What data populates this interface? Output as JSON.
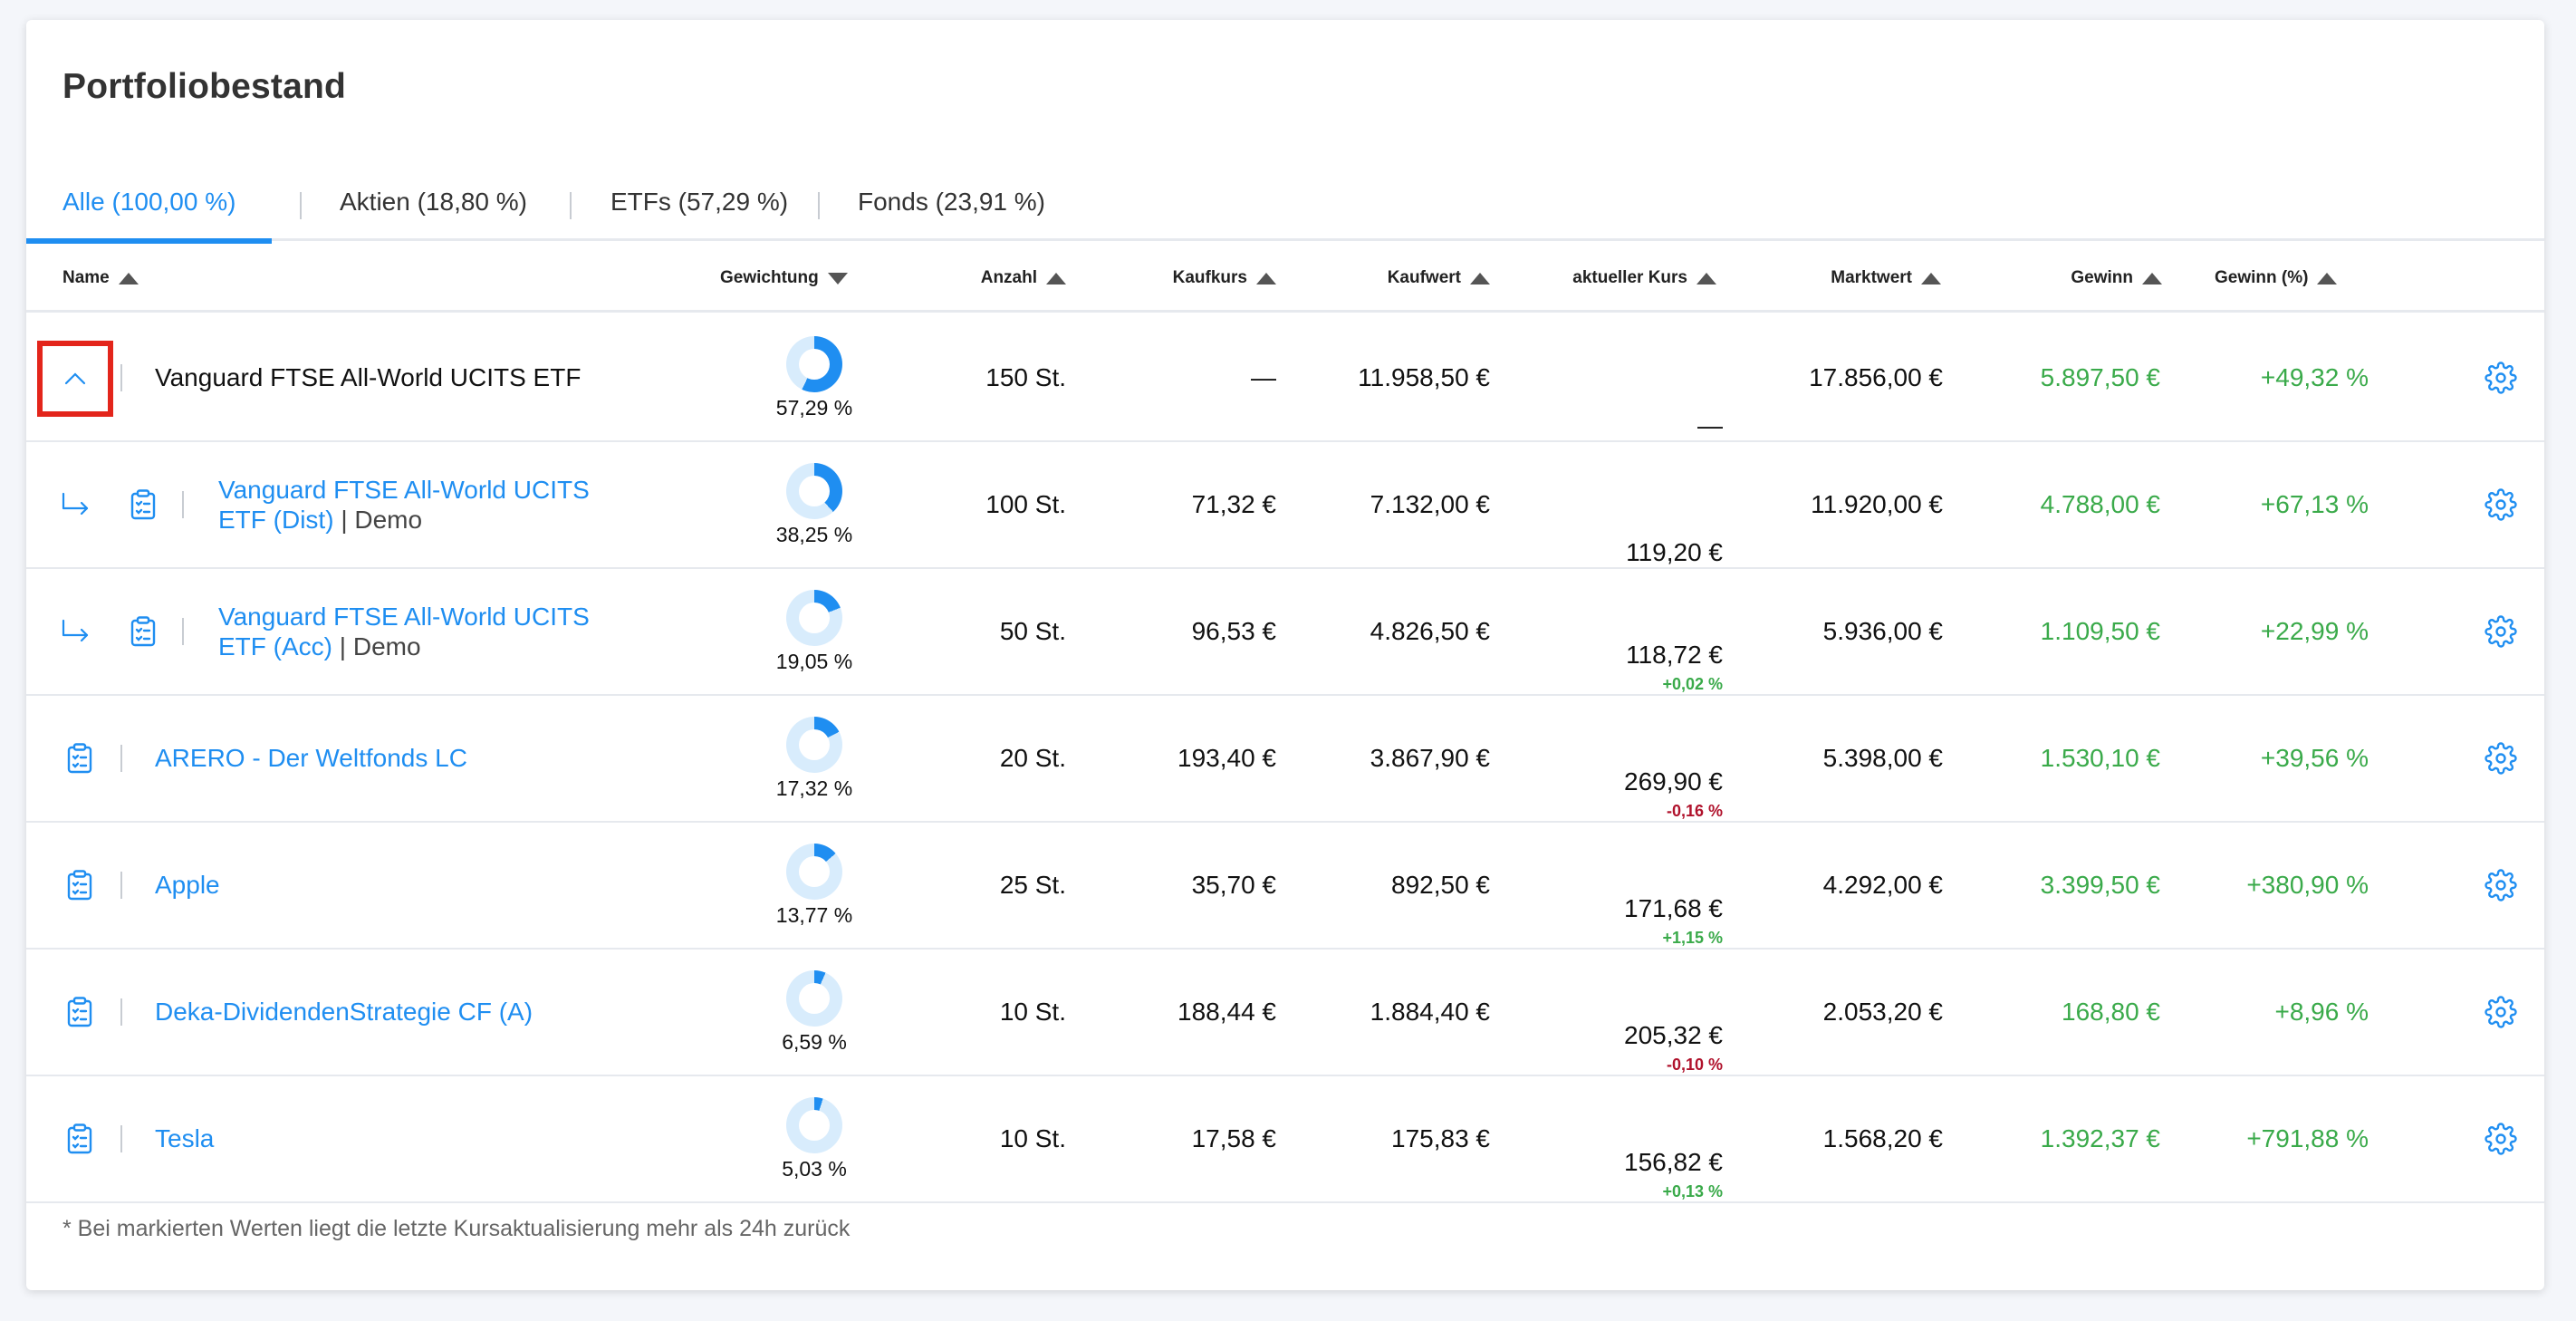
{
  "title": "Portfoliobestand",
  "tabs": [
    {
      "label": "Alle (100,00 %)"
    },
    {
      "label": "Aktien (18,80 %)"
    },
    {
      "label": "ETFs (57,29 %)"
    },
    {
      "label": "Fonds (23,91 %)"
    }
  ],
  "columns": {
    "name": "Name",
    "gewichtung": "Gewichtung",
    "anzahl": "Anzahl",
    "kaufkurs": "Kaufkurs",
    "kaufwert": "Kaufwert",
    "aktueller_kurs": "aktueller Kurs",
    "marktwert": "Marktwert",
    "gewinn": "Gewinn",
    "gewinn_pct": "Gewinn (%)"
  },
  "colors": {
    "accent": "#1f8ef1",
    "positive": "#3aaa4a",
    "negative": "#b0122c",
    "highlight_box": "#e3251b",
    "donut_light": "#d8ecfc"
  },
  "rows": [
    {
      "name": "Vanguard FTSE All-World UCITS ETF",
      "weight_label": "57,29 %",
      "weight": 57.29,
      "anzahl": "150 St.",
      "kaufkurs": "—",
      "kaufwert": "11.958,50 €",
      "kurs": "—",
      "kurs_change": "",
      "marktwert": "17.856,00 €",
      "gewinn": "5.897,50 €",
      "gewinn_pct": "+49,32 %"
    },
    {
      "name_line1": "Vanguard FTSE All-World UCITS",
      "name_line2": "ETF (Dist)",
      "suffix": "Demo",
      "weight_label": "38,25 %",
      "weight": 38.25,
      "anzahl": "100 St.",
      "kaufkurs": "71,32 €",
      "kaufwert": "7.132,00 €",
      "kurs": "119,20 €",
      "kurs_change": "",
      "marktwert": "11.920,00 €",
      "gewinn": "4.788,00 €",
      "gewinn_pct": "+67,13 %"
    },
    {
      "name_line1": "Vanguard FTSE All-World UCITS",
      "name_line2": "ETF (Acc)",
      "suffix": "Demo",
      "weight_label": "19,05 %",
      "weight": 19.05,
      "anzahl": "50 St.",
      "kaufkurs": "96,53 €",
      "kaufwert": "4.826,50 €",
      "kurs": "118,72 €",
      "kurs_change": "+0,02 %",
      "marktwert": "5.936,00 €",
      "gewinn": "1.109,50 €",
      "gewinn_pct": "+22,99 %"
    },
    {
      "name": "ARERO - Der Weltfonds LC",
      "weight_label": "17,32 %",
      "weight": 17.32,
      "anzahl": "20 St.",
      "kaufkurs": "193,40 €",
      "kaufwert": "3.867,90 €",
      "kurs": "269,90 €",
      "kurs_change": "-0,16 %",
      "marktwert": "5.398,00 €",
      "gewinn": "1.530,10 €",
      "gewinn_pct": "+39,56 %"
    },
    {
      "name": "Apple",
      "weight_label": "13,77 %",
      "weight": 13.77,
      "anzahl": "25 St.",
      "kaufkurs": "35,70 €",
      "kaufwert": "892,50 €",
      "kurs": "171,68 €",
      "kurs_change": "+1,15 %",
      "marktwert": "4.292,00 €",
      "gewinn": "3.399,50 €",
      "gewinn_pct": "+380,90 %"
    },
    {
      "name": "Deka-DividendenStrategie CF (A)",
      "weight_label": "6,59 %",
      "weight": 6.59,
      "anzahl": "10 St.",
      "kaufkurs": "188,44 €",
      "kaufwert": "1.884,40 €",
      "kurs": "205,32 €",
      "kurs_change": "-0,10 %",
      "marktwert": "2.053,20 €",
      "gewinn": "168,80 €",
      "gewinn_pct": "+8,96 %"
    },
    {
      "name": "Tesla",
      "weight_label": "5,03 %",
      "weight": 5.03,
      "anzahl": "10 St.",
      "kaufkurs": "17,58 €",
      "kaufwert": "175,83 €",
      "kurs": "156,82 €",
      "kurs_change": "+0,13 %",
      "marktwert": "1.568,20 €",
      "gewinn": "1.392,37 €",
      "gewinn_pct": "+791,88 %"
    }
  ],
  "footnote": "* Bei markierten Werten liegt die letzte Kursaktualisierung mehr als 24h zurück"
}
